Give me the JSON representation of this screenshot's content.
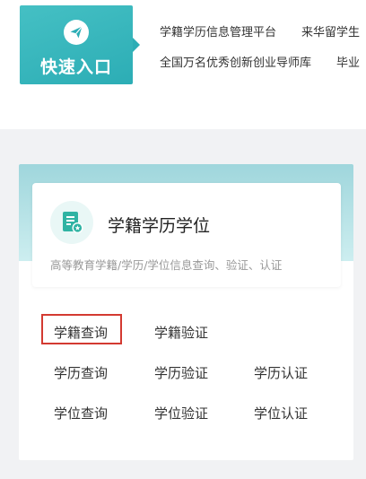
{
  "quick_entry": {
    "label": "快速入口",
    "icon": "paper-plane-icon",
    "accent_color": "#36b6bc"
  },
  "links": {
    "row1": [
      "学籍学历信息管理平台",
      "来华留学生"
    ],
    "row2": [
      "全国万名优秀创新创业导师库",
      "毕业"
    ]
  },
  "card": {
    "icon": "certificate-icon",
    "title": "学籍学历学位",
    "description": "高等教育学籍/学历/学位信息查询、验证、认证",
    "actions": {
      "r1": [
        "学籍查询",
        "学籍验证"
      ],
      "r2": [
        "学历查询",
        "学历验证",
        "学历认证"
      ],
      "r3": [
        "学位查询",
        "学位验证",
        "学位认证"
      ]
    },
    "highlighted_action": "学籍查询",
    "highlight_color": "#d33a31"
  }
}
